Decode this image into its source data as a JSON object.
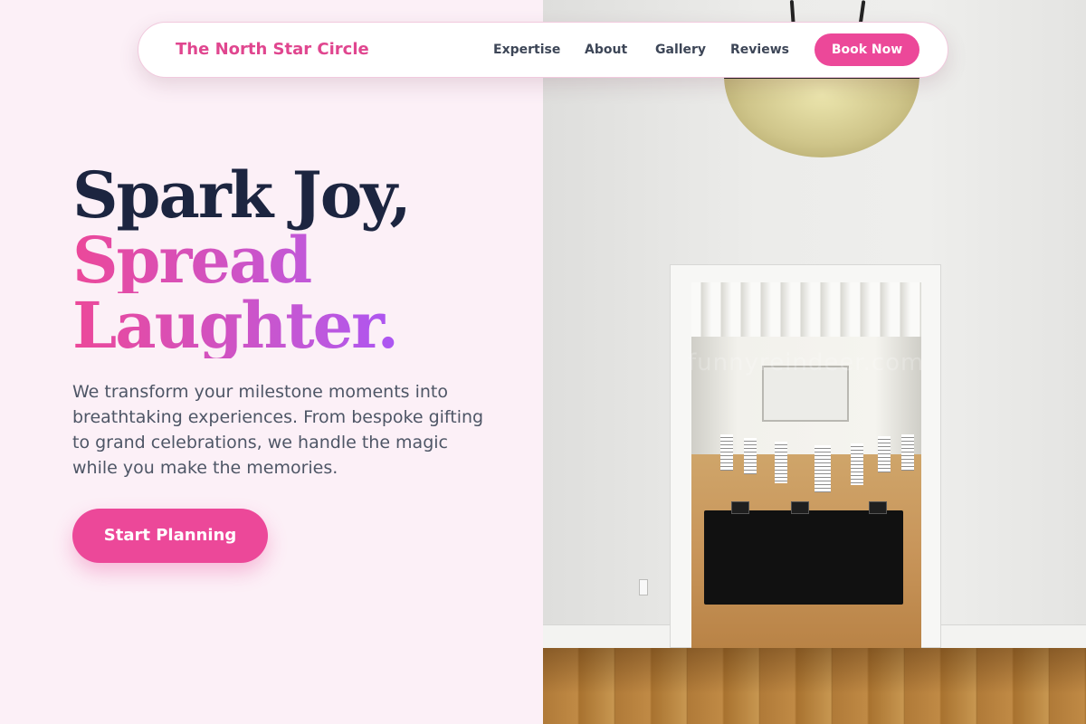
{
  "nav": {
    "brand": "The North Star Circle",
    "links": [
      "Expertise",
      "About",
      "Gallery",
      "Reviews"
    ],
    "cta_label": "Book Now"
  },
  "hero": {
    "title_line_1": "Spark Joy,",
    "title_line_2": "Spread",
    "title_line_3": "Laughter.",
    "description": "We transform your milestone moments into breathtaking experiences. From bespoke gifting to grand celebrations, we handle the magic while you make the memories.",
    "cta_label": "Start Planning"
  },
  "photo": {
    "watermark": "funnyreindeer.com"
  },
  "colors": {
    "background": "#fcf0f7",
    "accent": "#ec4899",
    "accent_purple": "#a855f7",
    "heading": "#1c2540",
    "body_text": "#4e5666"
  }
}
